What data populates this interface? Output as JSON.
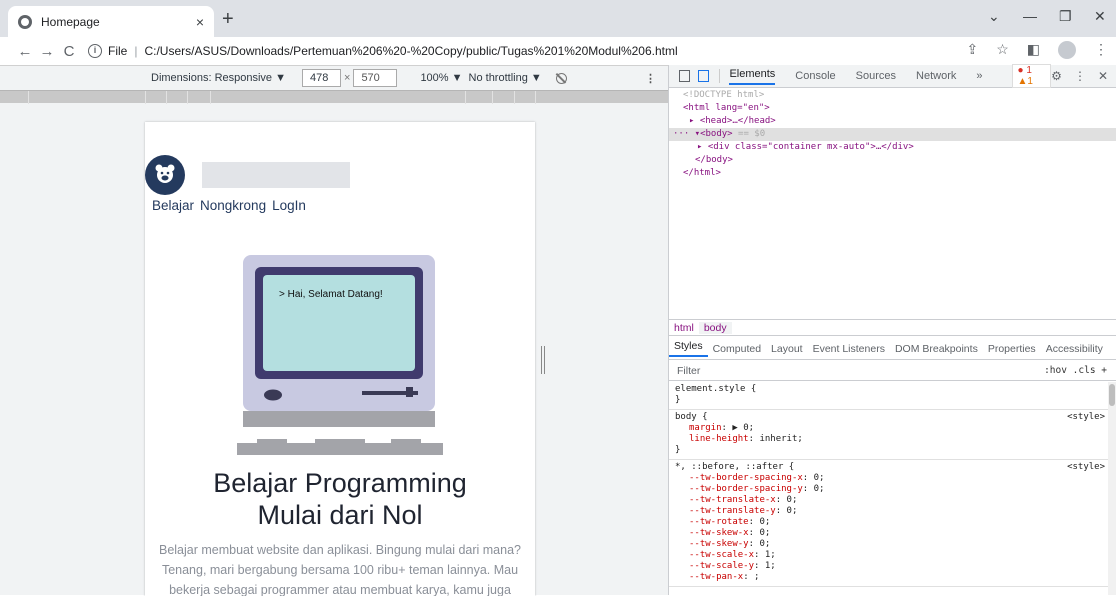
{
  "browser": {
    "tab_title": "Homepage",
    "tab_close": "×",
    "new_tab": "+",
    "address_prefix": "File",
    "url": "C:/Users/ASUS/Downloads/Pertemuan%206%20-%20Copy/public/Tugas%201%20Modul%206.html"
  },
  "device_toolbar": {
    "dimensions_label": "Dimensions: Responsive ▼",
    "width": "478",
    "times": "×",
    "height": "570",
    "zoom": "100% ▼",
    "throttling": "No throttling ▼"
  },
  "page": {
    "nav": [
      "Belajar",
      "Nongkrong",
      "LogIn"
    ],
    "monitor_text": "> Hai, Selamat Datang!",
    "heading_line1": "Belajar Programming",
    "heading_line2": "Mulai dari Nol",
    "paragraph": "Belajar membuat website dan aplikasi. Bingung mulai dari mana? Tenang, mari bergabung bersama 100 ribu+ teman lainnya. Mau bekerja sebagai programmer atau membuat karya, kamu juga"
  },
  "devtools": {
    "tabs": [
      "Elements",
      "Console",
      "Sources",
      "Network",
      "»"
    ],
    "error_count": "1",
    "warning_count": "1",
    "dom": {
      "doctype": "<!DOCTYPE html>",
      "html_open": "<html lang=\"en\">",
      "head": "<head>…</head>",
      "body_open": "<body>",
      "body_marker": "== $0",
      "div": "<div class=\"container mx-auto\">…</div>",
      "body_close": "</body>",
      "html_close": "</html>"
    },
    "breadcrumbs": [
      "html",
      "body"
    ],
    "style_tabs": [
      "Styles",
      "Computed",
      "Layout",
      "Event Listeners",
      "DOM Breakpoints",
      "Properties",
      "Accessibility"
    ],
    "filter_placeholder": "Filter",
    "filter_options": ":hov  .cls  +",
    "rules": [
      {
        "selector": "element.style {",
        "source": "",
        "props": [],
        "close": "}"
      },
      {
        "selector": "body {",
        "source": "<style>",
        "props": [
          [
            "margin",
            ": ▶ 0;"
          ],
          [
            "line-height",
            ": inherit;"
          ]
        ],
        "close": "}"
      },
      {
        "selector": "*, ::before, ::after {",
        "source": "<style>",
        "props": [
          [
            "--tw-border-spacing-x",
            ": 0;"
          ],
          [
            "--tw-border-spacing-y",
            ": 0;"
          ],
          [
            "--tw-translate-x",
            ": 0;"
          ],
          [
            "--tw-translate-y",
            ": 0;"
          ],
          [
            "--tw-rotate",
            ": 0;"
          ],
          [
            "--tw-skew-x",
            ": 0;"
          ],
          [
            "--tw-skew-y",
            ": 0;"
          ],
          [
            "--tw-scale-x",
            ": 1;"
          ],
          [
            "--tw-scale-y",
            ": 1;"
          ],
          [
            "--tw-pan-x",
            ": ;"
          ]
        ],
        "close": ""
      }
    ]
  }
}
